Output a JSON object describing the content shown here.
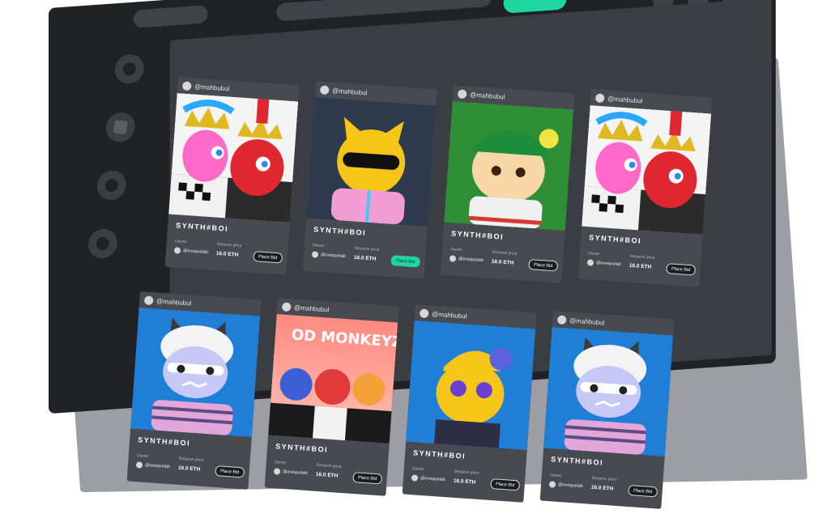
{
  "cards": [
    {
      "username": "@mahbubul",
      "title": "SYNTH#BOI",
      "owner_label": "Owner",
      "reserve_label": "Reserve price",
      "owner": "@evequelab",
      "price": "16.0 ETH",
      "bid": "Place Bid",
      "art": "kings"
    },
    {
      "username": "@mahbubul",
      "title": "SYNTH#BOI",
      "owner_label": "Owner",
      "reserve_label": "Reserve price",
      "owner": "@evequelab",
      "price": "16.0 ETH",
      "bid": "Place Bid",
      "art": "cat-yellow"
    },
    {
      "username": "@mahbubul",
      "title": "SYNTH#BOI",
      "owner_label": "Owner",
      "reserve_label": "Reserve price",
      "owner": "@evequelab",
      "price": "16.0 ETH",
      "bid": "Place Bid",
      "art": "cat-green"
    },
    {
      "username": "@mahbubul",
      "title": "SYNTH#BOI",
      "owner_label": "Owner",
      "reserve_label": "Reserve price",
      "owner": "@evequelab",
      "price": "16.0 ETH",
      "bid": "Place Bid",
      "art": "kings"
    },
    {
      "username": "@mahbubul",
      "title": "SYNTH#BOI",
      "owner_label": "Owner",
      "reserve_label": "Reserve price",
      "owner": "@evequelab",
      "price": "16.0 ETH",
      "bid": "Place Bid",
      "art": "cat-blue"
    },
    {
      "username": "@mahbubul",
      "title": "SYNTH#BOI",
      "owner_label": "Owner",
      "reserve_label": "Reserve price",
      "owner": "@evequelab",
      "price": "16.0 ETH",
      "bid": "Place Bid",
      "art": "monkeys"
    },
    {
      "username": "@mahbubul",
      "title": "SYNTH#BOI",
      "owner_label": "Owner",
      "reserve_label": "Reserve price",
      "owner": "@evequelab",
      "price": "16.0 ETH",
      "bid": "Place Bid",
      "art": "cat-cap"
    },
    {
      "username": "@mahbubul",
      "title": "SYNTH#BOI",
      "owner_label": "Owner",
      "reserve_label": "Reserve price",
      "owner": "@evequelab",
      "price": "16.0 ETH",
      "bid": "Place Bid",
      "art": "cat-blue"
    }
  ],
  "monkey_banner": "OD MONKEYZ",
  "colors": {
    "accent": "#20d6a0",
    "frame": "#202226",
    "content": "#3a3d42",
    "card": "#474a50",
    "back_panel": "#9c9ea3"
  }
}
